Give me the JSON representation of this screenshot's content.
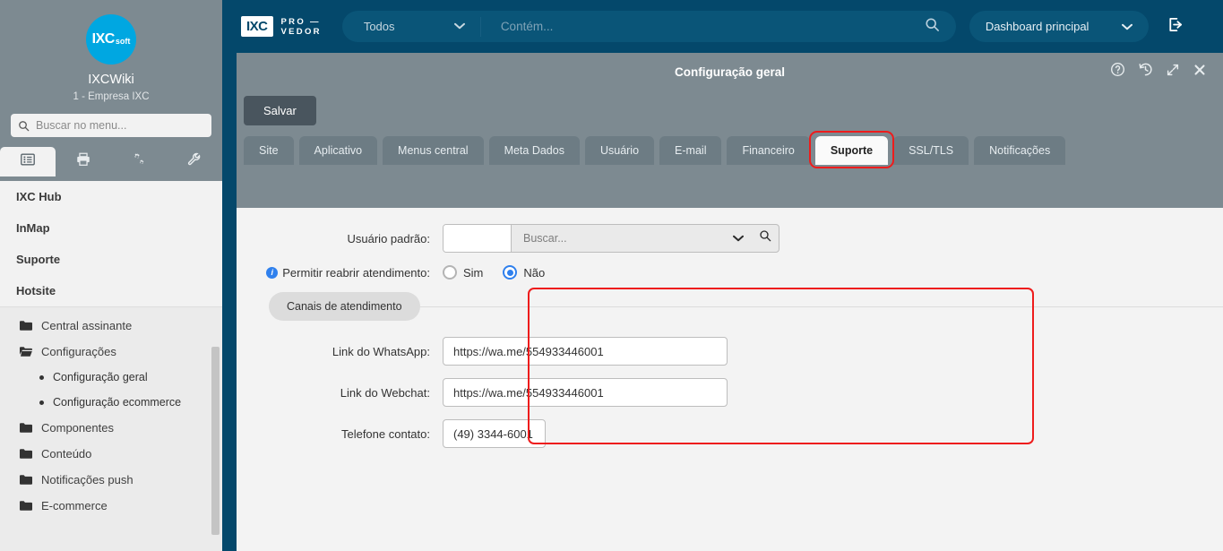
{
  "sidebar": {
    "logo": {
      "text_main": "IXC",
      "text_sub": "soft"
    },
    "account_title": "IXCWiki",
    "account_subtitle": "1 - Empresa IXC",
    "search_placeholder": "Buscar no menu...",
    "icon_tabs": [
      {
        "name": "menu-list-icon",
        "label": "menu"
      },
      {
        "name": "printer-icon",
        "label": "printer"
      },
      {
        "name": "gears-icon",
        "label": "gears"
      },
      {
        "name": "wrench-icon",
        "label": "wrench"
      }
    ],
    "groups": [
      {
        "label": "IXC Hub"
      },
      {
        "label": "InMap"
      },
      {
        "label": "Suporte"
      },
      {
        "label": "Hotsite"
      }
    ],
    "tree": [
      {
        "label": "Central assinante",
        "type": "folder",
        "open": false
      },
      {
        "label": "Configurações",
        "type": "folder",
        "open": true
      },
      {
        "label": "Configuração geral",
        "type": "leaf"
      },
      {
        "label": "Configuração ecommerce",
        "type": "leaf"
      },
      {
        "label": "Componentes",
        "type": "folder",
        "open": false
      },
      {
        "label": "Conteúdo",
        "type": "folder",
        "open": false
      },
      {
        "label": "Notificações push",
        "type": "folder",
        "open": false
      },
      {
        "label": "E-commerce",
        "type": "folder",
        "open": false
      }
    ]
  },
  "topbar": {
    "brand_mark": "IXC",
    "brand_word_line1": "PRO —",
    "brand_word_line2": "VEDOR",
    "scope_select": "Todos",
    "search_placeholder": "Contém...",
    "dashboard_select": "Dashboard principal",
    "logout_icon": "logout-icon"
  },
  "panel": {
    "title": "Configuração geral",
    "icons": [
      {
        "name": "help-icon",
        "glyph": "?"
      },
      {
        "name": "history-icon",
        "glyph": "history"
      },
      {
        "name": "expand-icon",
        "glyph": "expand"
      },
      {
        "name": "close-icon",
        "glyph": "✖"
      }
    ],
    "save_label": "Salvar"
  },
  "tabs": [
    {
      "label": "Site",
      "active": false
    },
    {
      "label": "Aplicativo",
      "active": false
    },
    {
      "label": "Menus central",
      "active": false
    },
    {
      "label": "Meta Dados",
      "active": false
    },
    {
      "label": "Usuário",
      "active": false
    },
    {
      "label": "E-mail",
      "active": false
    },
    {
      "label": "Financeiro",
      "active": false
    },
    {
      "label": "Suporte",
      "active": true
    },
    {
      "label": "SSL/TLS",
      "active": false
    },
    {
      "label": "Notificações",
      "active": false
    }
  ],
  "form": {
    "default_user": {
      "label": "Usuário padrão:",
      "value": "",
      "search_placeholder": "Buscar..."
    },
    "reopen_ticket": {
      "label": "Permitir reabrir atendimento:",
      "options": [
        {
          "label": "Sim",
          "selected": false
        },
        {
          "label": "Não",
          "selected": true
        }
      ]
    },
    "channels": {
      "legend": "Canais de atendimento",
      "whatsapp": {
        "label": "Link do WhatsApp:",
        "value": "https://wa.me/554933446001"
      },
      "webchat": {
        "label": "Link do Webchat:",
        "value": "https://wa.me/554933446001"
      },
      "phone": {
        "label": "Telefone contato:",
        "value": "(49) 3344-6001"
      }
    }
  },
  "colors": {
    "topbar": "#04486b",
    "sidebar": "#7d8a91",
    "accent_blue": "#2f80ed",
    "logo_blue": "#00a7e1",
    "highlight_red": "#ee1c1c"
  }
}
